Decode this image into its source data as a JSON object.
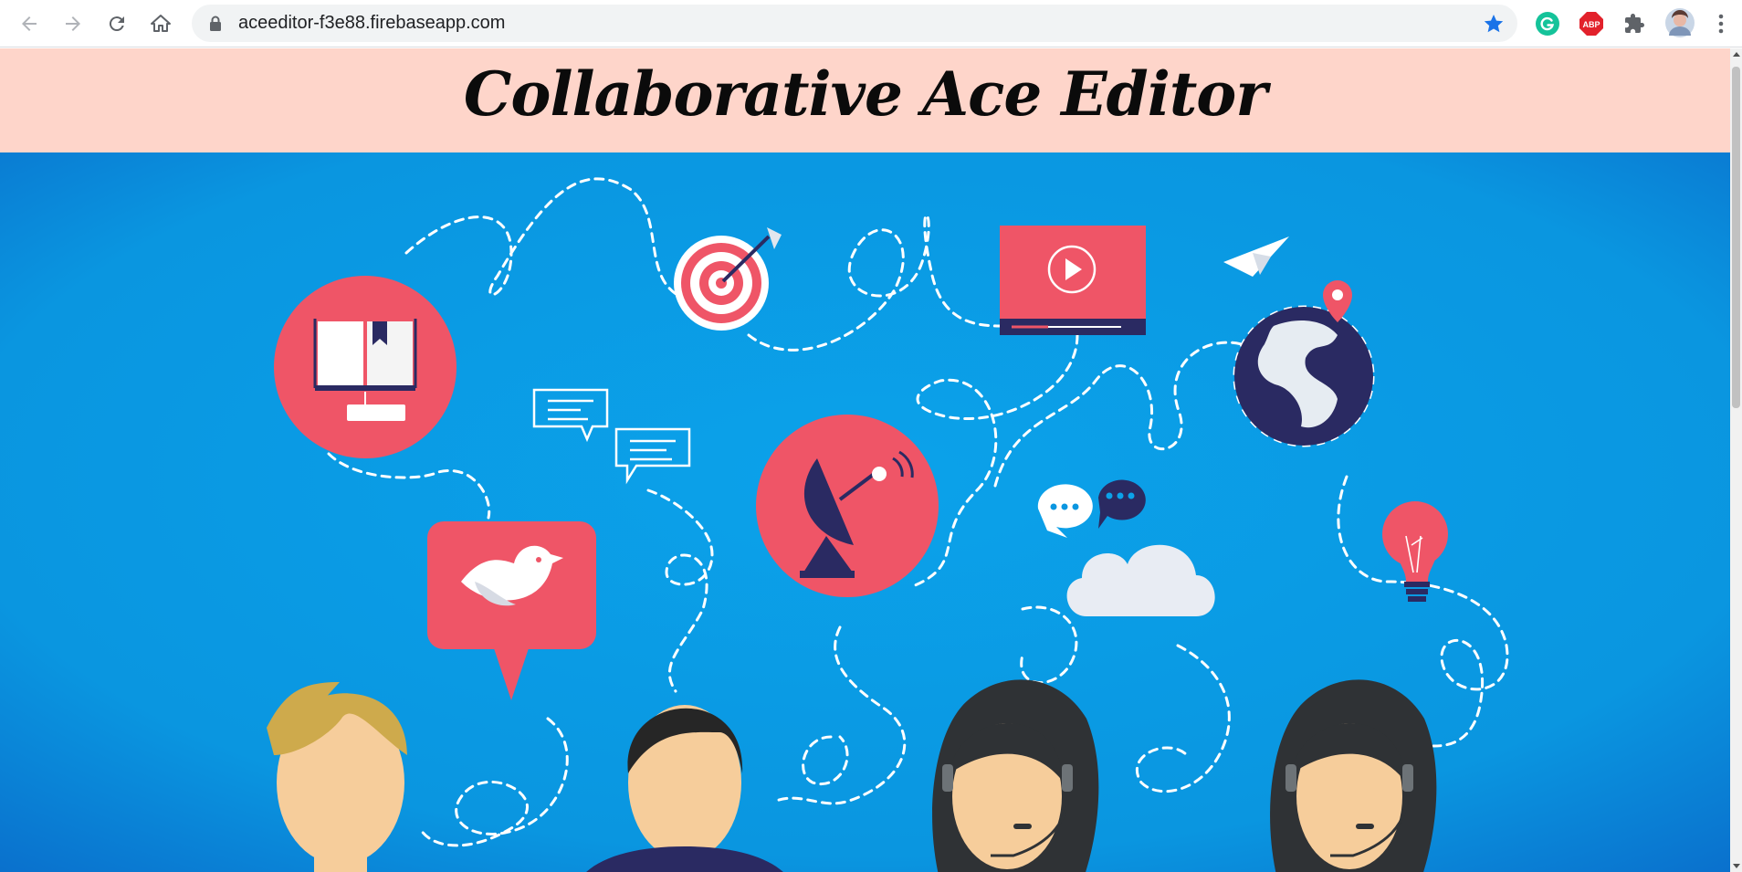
{
  "browser": {
    "url": "aceeditor-f3e88.firebaseapp.com",
    "extensions": [
      {
        "name": "grammarly-icon",
        "label": ""
      },
      {
        "name": "adblock-plus-icon",
        "label": "ABP"
      },
      {
        "name": "extensions-puzzle-icon",
        "label": ""
      }
    ]
  },
  "page": {
    "title": "Collaborative Ace Editor"
  },
  "colors": {
    "header_bg": "#fed5ca",
    "hero_bg": "#0a96e0",
    "icon_coral": "#ef5567",
    "navy": "#2a2a62"
  }
}
